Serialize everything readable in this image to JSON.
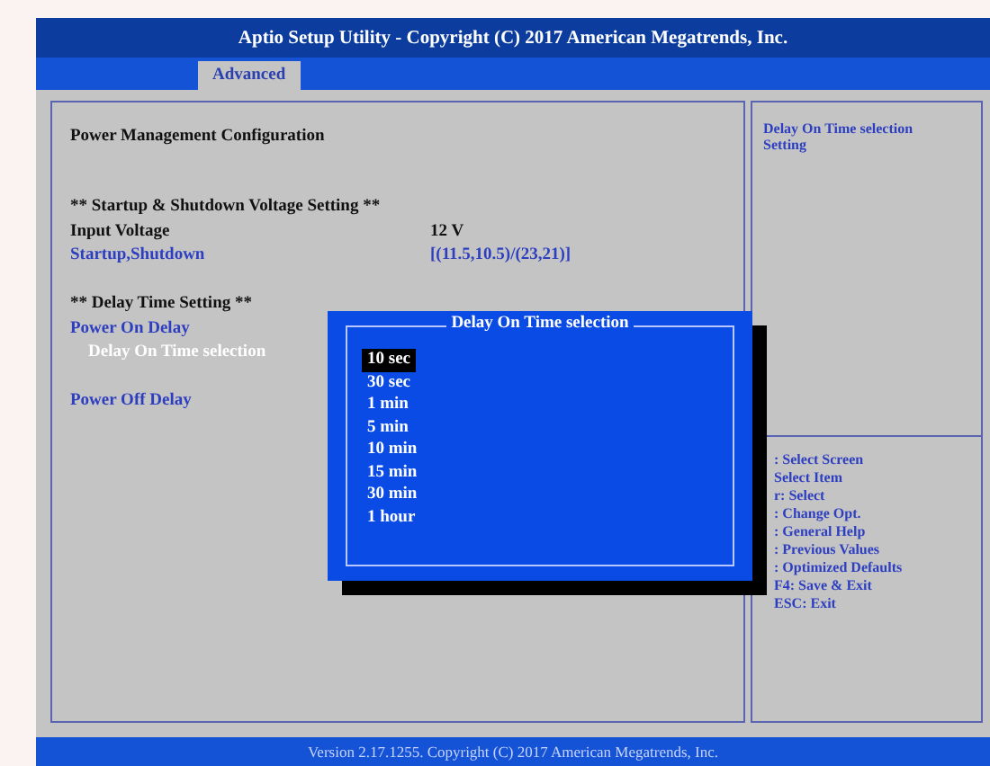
{
  "window": {
    "title": "Aptio Setup Utility - Copyright (C) 2017 American Megatrends, Inc."
  },
  "tabs": [
    {
      "label": "Advanced",
      "selected": true
    }
  ],
  "main": {
    "title": "Power Management Configuration",
    "items": [
      {
        "kind": "blank"
      },
      {
        "kind": "heading",
        "label": "** Startup & Shutdown Voltage Setting **"
      },
      {
        "kind": "info",
        "label": "Input Voltage",
        "value": "12 V"
      },
      {
        "kind": "setting",
        "label": "Startup,Shutdown",
        "value": "[(11.5,10.5)/(23,21)]",
        "selected": false
      },
      {
        "kind": "blank"
      },
      {
        "kind": "heading",
        "label": "** Delay Time Setting **"
      },
      {
        "kind": "setting",
        "label": "Power On Delay",
        "selected": false
      },
      {
        "kind": "sub",
        "label": "Delay On Time selection",
        "selected": true
      },
      {
        "kind": "blank"
      },
      {
        "kind": "setting",
        "label": "Power Off Delay",
        "selected": false
      }
    ]
  },
  "help": {
    "text": "Delay On Time selection Setting",
    "keys": [
      ": Select Screen",
      "Select Item",
      "r: Select",
      ": Change Opt.",
      ": General Help",
      ": Previous Values",
      ": Optimized Defaults",
      "F4: Save & Exit",
      "ESC: Exit"
    ]
  },
  "popup": {
    "title": "Delay On Time selection",
    "options": [
      {
        "label": "10 sec",
        "selected": true
      },
      {
        "label": "30 sec",
        "selected": false
      },
      {
        "label": "1 min",
        "selected": false
      },
      {
        "label": "5 min",
        "selected": false
      },
      {
        "label": "10 min",
        "selected": false
      },
      {
        "label": "15 min",
        "selected": false
      },
      {
        "label": "30 min",
        "selected": false
      },
      {
        "label": "1 hour",
        "selected": false
      }
    ]
  },
  "status_bar": "Version 2.17.1255. Copyright (C) 2017 American Megatrends, Inc."
}
